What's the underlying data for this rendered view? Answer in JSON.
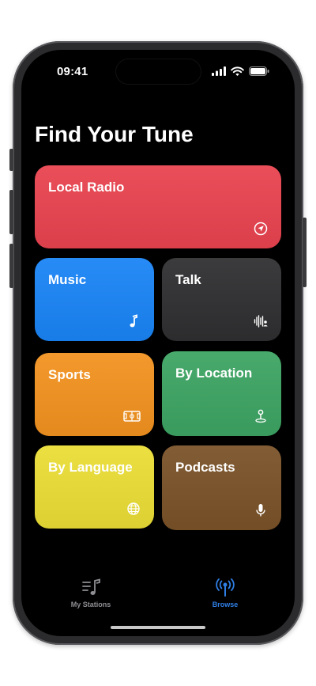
{
  "status": {
    "time": "09:41"
  },
  "page": {
    "title": "Find Your Tune"
  },
  "tiles": [
    {
      "label": "Local Radio",
      "icon": "location-arrow-icon",
      "color": "#e8434f"
    },
    {
      "label": "Music",
      "icon": "music-note-icon",
      "color": "#1a84f6"
    },
    {
      "label": "Talk",
      "icon": "waveform-icon",
      "color": "#2f2f31"
    },
    {
      "label": "Sports",
      "icon": "sports-field-icon",
      "color": "#f2921f"
    },
    {
      "label": "By Location",
      "icon": "map-pin-icon",
      "color": "#3da463"
    },
    {
      "label": "By Language",
      "icon": "globe-icon",
      "color": "#eadd36"
    },
    {
      "label": "Podcasts",
      "icon": "microphone-icon",
      "color": "#7a5228"
    }
  ],
  "tabbar": {
    "items": [
      {
        "label": "My Stations",
        "icon": "music-list-icon",
        "active": false
      },
      {
        "label": "Browse",
        "icon": "broadcast-icon",
        "active": true
      }
    ],
    "active_color": "#2f7fe6",
    "inactive_color": "#8e8e93"
  }
}
